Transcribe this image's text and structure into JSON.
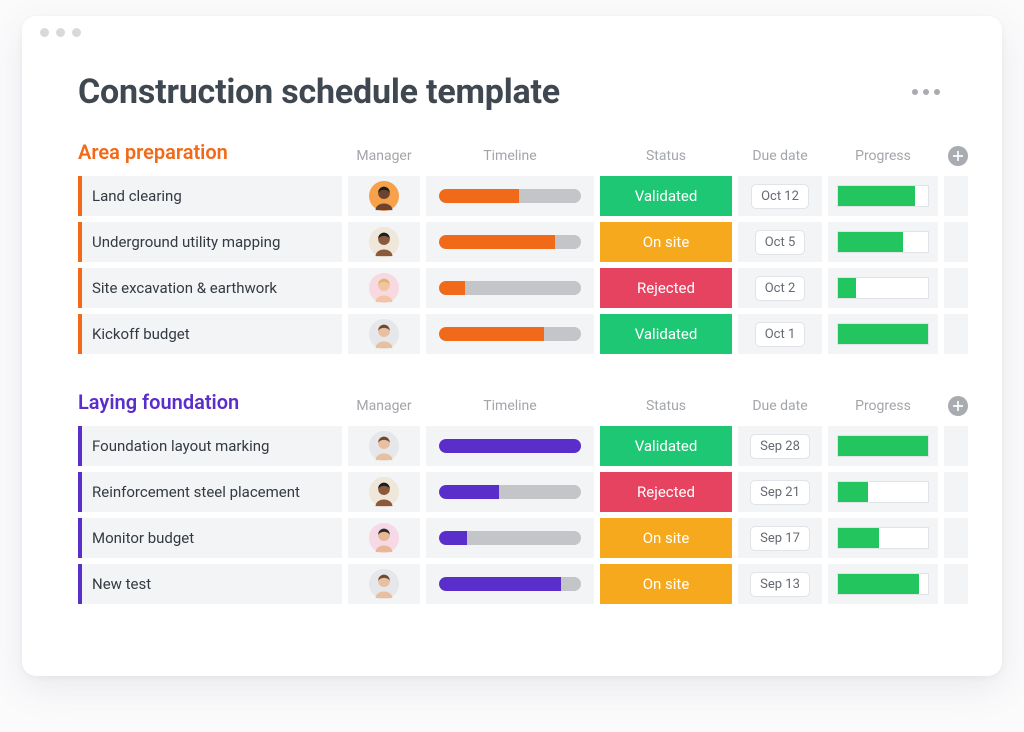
{
  "page_title": "Construction schedule template",
  "column_labels": {
    "manager": "Manager",
    "timeline": "Timeline",
    "status": "Status",
    "due_date": "Due date",
    "progress": "Progress"
  },
  "status_colors": {
    "Validated": "#1ec773",
    "On site": "#f6a91c",
    "Rejected": "#e54360"
  },
  "sections": [
    {
      "title": "Area preparation",
      "accent": "#f06a1a",
      "rows": [
        {
          "name": "Land clearing",
          "avatar": "orange-dark",
          "timeline_pct": 56,
          "status": "Validated",
          "due": "Oct 12",
          "progress_pct": 85
        },
        {
          "name": "Underground utility mapping",
          "avatar": "tan-dark",
          "timeline_pct": 82,
          "status": "On site",
          "due": "Oct 5",
          "progress_pct": 72
        },
        {
          "name": "Site excavation & earthwork",
          "avatar": "pink-blonde",
          "timeline_pct": 18,
          "status": "Rejected",
          "due": "Oct 2",
          "progress_pct": 20
        },
        {
          "name": "Kickoff budget",
          "avatar": "gray-brown",
          "timeline_pct": 74,
          "status": "Validated",
          "due": "Oct 1",
          "progress_pct": 100
        }
      ]
    },
    {
      "title": "Laying foundation",
      "accent": "#5a2ecb",
      "rows": [
        {
          "name": "Foundation layout marking",
          "avatar": "gray-brown",
          "timeline_pct": 100,
          "status": "Validated",
          "due": "Sep 28",
          "progress_pct": 100
        },
        {
          "name": "Reinforcement steel placement",
          "avatar": "tan-dark",
          "timeline_pct": 42,
          "status": "Rejected",
          "due": "Sep 21",
          "progress_pct": 33
        },
        {
          "name": "Monitor budget",
          "avatar": "pink-dark",
          "timeline_pct": 20,
          "status": "On site",
          "due": "Sep 17",
          "progress_pct": 45
        },
        {
          "name": "New test",
          "avatar": "gray-brown",
          "timeline_pct": 86,
          "status": "On site",
          "due": "Sep 13",
          "progress_pct": 90
        }
      ]
    }
  ],
  "avatars": {
    "orange-dark": {
      "bg": "#f7a14b",
      "skin": "#6b432e",
      "hair": "#1d1d1d"
    },
    "tan-dark": {
      "bg": "#efe7da",
      "skin": "#8a5a3a",
      "hair": "#1d1d1d"
    },
    "pink-blonde": {
      "bg": "#f8d9e2",
      "skin": "#f1c5a3",
      "hair": "#e0b46a"
    },
    "gray-brown": {
      "bg": "#e6e7ea",
      "skin": "#e8bfa0",
      "hair": "#6a4b32"
    },
    "pink-dark": {
      "bg": "#f7d8e6",
      "skin": "#e8b896",
      "hair": "#2b2b2b"
    }
  }
}
